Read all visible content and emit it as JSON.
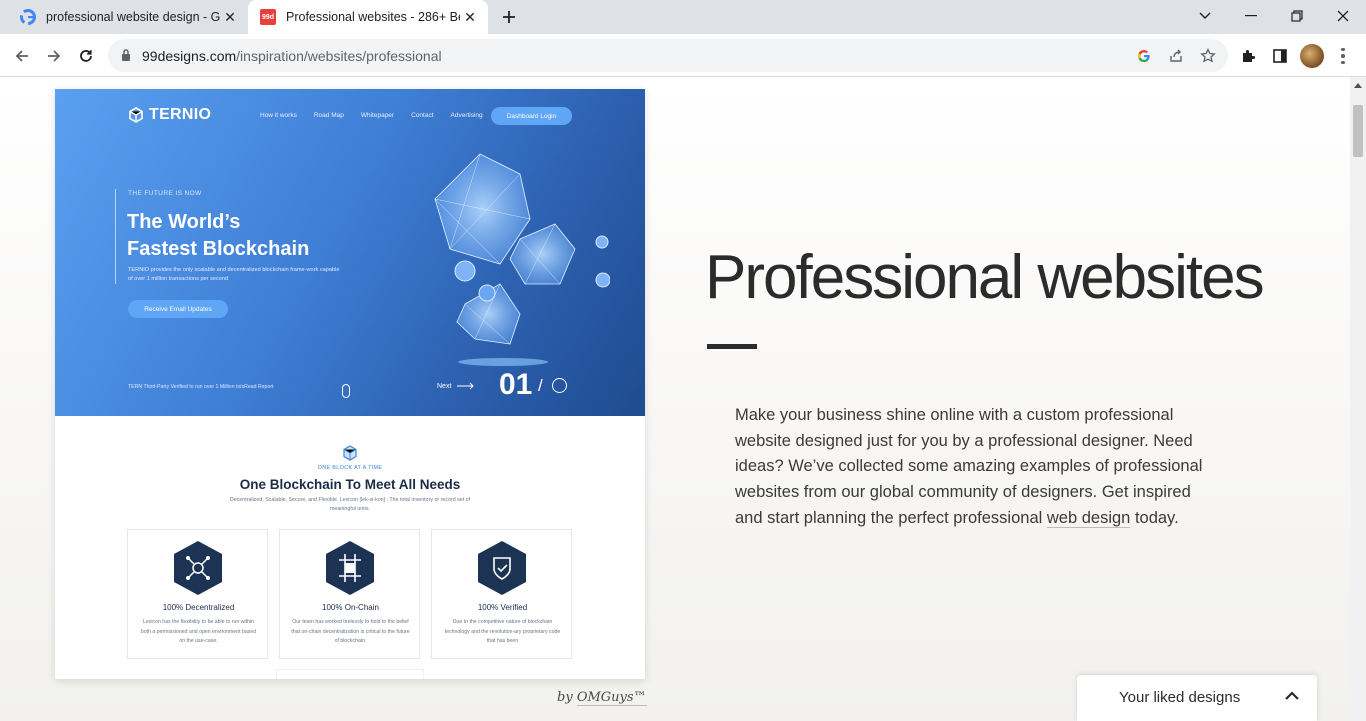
{
  "browser": {
    "tabs": [
      {
        "title": "professional website design - Go",
        "active": false,
        "favicon": "google-icon"
      },
      {
        "title": "Professional websites - 286+ Be",
        "active": true,
        "favicon": "99designs-icon",
        "favicon_text": "99d"
      }
    ],
    "url_host": "99designs.com",
    "url_path": "/inspiration/websites/professional"
  },
  "showcase": {
    "brand": "TERNIO",
    "nav": [
      "How it works",
      "Road Map",
      "Whitepaper",
      "Contact",
      "Advertising"
    ],
    "dashboard_label": "Dashboard Login",
    "eyebrow": "THE FUTURE IS NOW",
    "headline_line1": "The World’s",
    "headline_line2": "Fastest Blockchain",
    "description": "TERNIO provides the only scalable and decentralized blockchain frame-work capable of over 1 million transactions per second",
    "cta": "Receive Email Updates",
    "footer_note": "TERN Third-Party Verified to run over 1 Million tx/sRead Report",
    "next_label": "Next",
    "slide_number": "01",
    "slide_sep": "/",
    "kicker": "ONE BLOCK AT A TIME",
    "section_title": "One Blockchain To Meet All Needs",
    "section_sub": "Decentralized, Scalable, Secure, and Flexible. Lexicon [lek-si-kon] : The total inventory or record set of meaningful units.",
    "cards": [
      {
        "title": "100% Decentralized",
        "desc": "Lexicon has the flexibility to be able to run within both a permissioned and open environment based on the use-case.",
        "icon": "network-icon"
      },
      {
        "title": "100% On-Chain",
        "desc": "Our team has worked tirelessly to hold to the belief that on-chain decentralization is critical to the future of blockchain.",
        "icon": "chain-icon"
      },
      {
        "title": "100% Verified",
        "desc": "Due to the competitive nature of blockchain technology and the revolution-ary proprietary code that has been",
        "icon": "shield-check-icon"
      }
    ],
    "accent": "#5fa6f6",
    "navy": "#1d3354"
  },
  "credit": {
    "prefix": "by",
    "designer": "OMGuys™"
  },
  "main": {
    "title": "Professional websites",
    "para_text": "Make your business shine online with a custom professional website designed just for you by a professional designer. Need ideas? We’ve collected some amazing examples of professional websites from our global community of designers. Get inspired and start planning the perfect professional ",
    "para_link": "web design",
    "para_end": " today."
  },
  "liked": {
    "label": "Your liked designs"
  }
}
